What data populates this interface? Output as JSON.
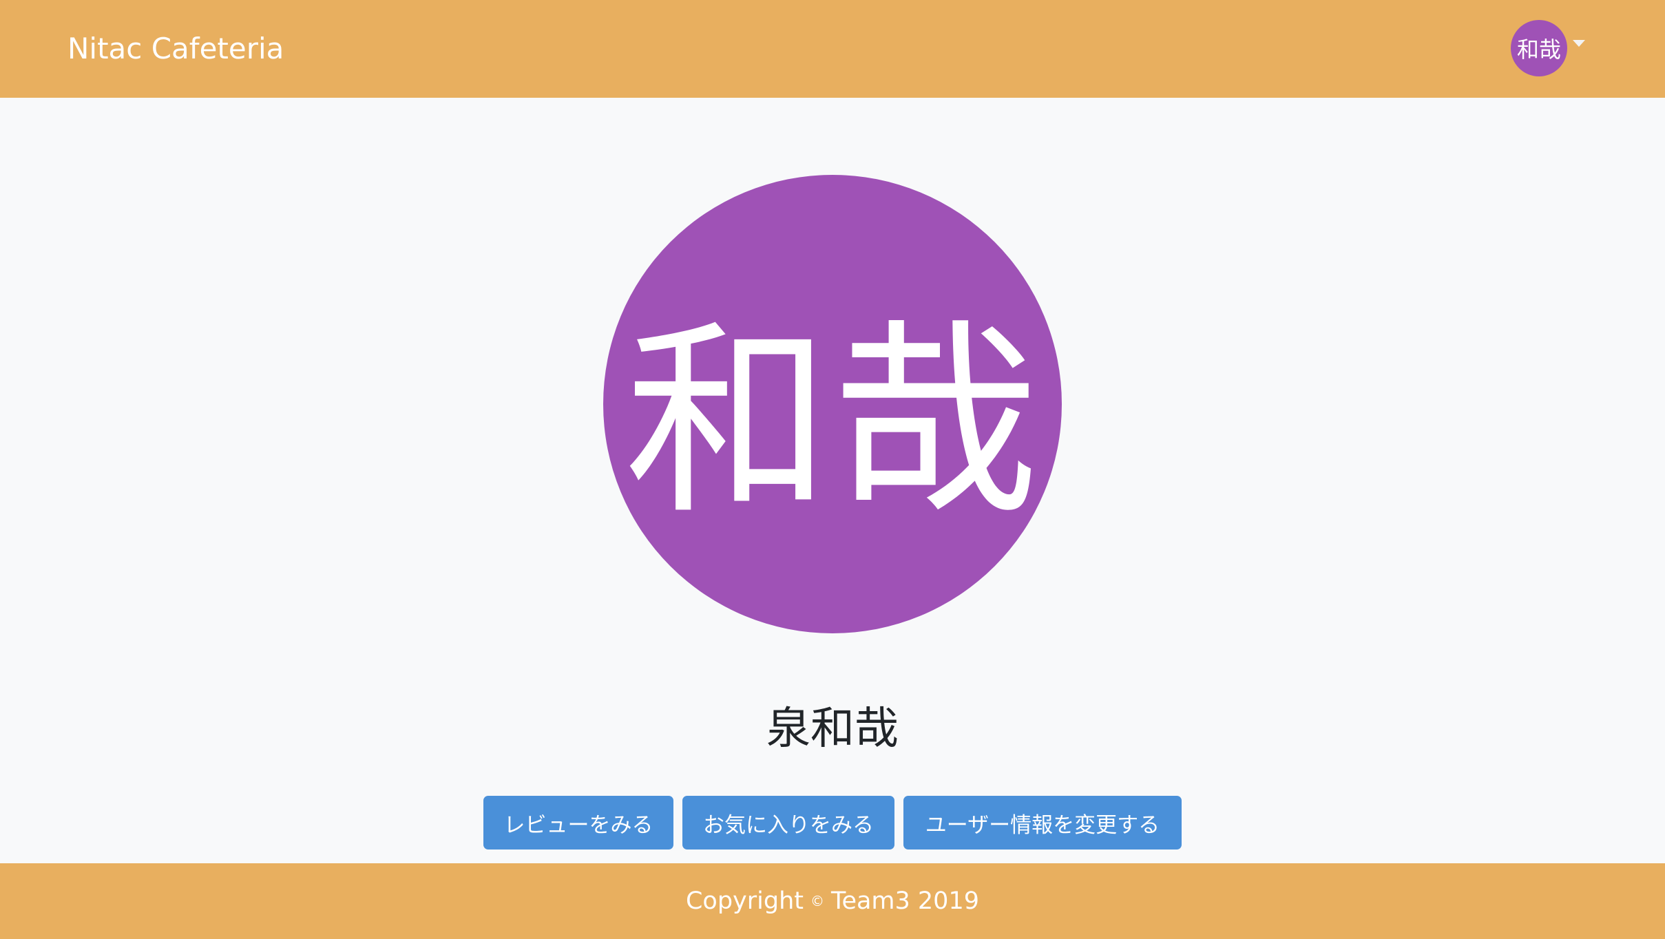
{
  "header": {
    "brand": "Nitac Cafeteria",
    "user_initials": "和哉",
    "dropdown_icon": "caret-down-icon"
  },
  "profile": {
    "avatar_text": "和哉",
    "full_name": "泉和哉"
  },
  "actions": {
    "view_reviews": "レビューをみる",
    "view_favorites": "お気に入りをみる",
    "edit_user_info": "ユーザー情報を変更する"
  },
  "footer": {
    "copyright_label": "Copyright",
    "copyright_symbol": "©",
    "copyright_owner": "Team3 2019"
  },
  "colors": {
    "navbar": "#e8af5f",
    "avatar": "#9f52b6",
    "button": "#4a90d9",
    "background": "#f8f9fa"
  }
}
